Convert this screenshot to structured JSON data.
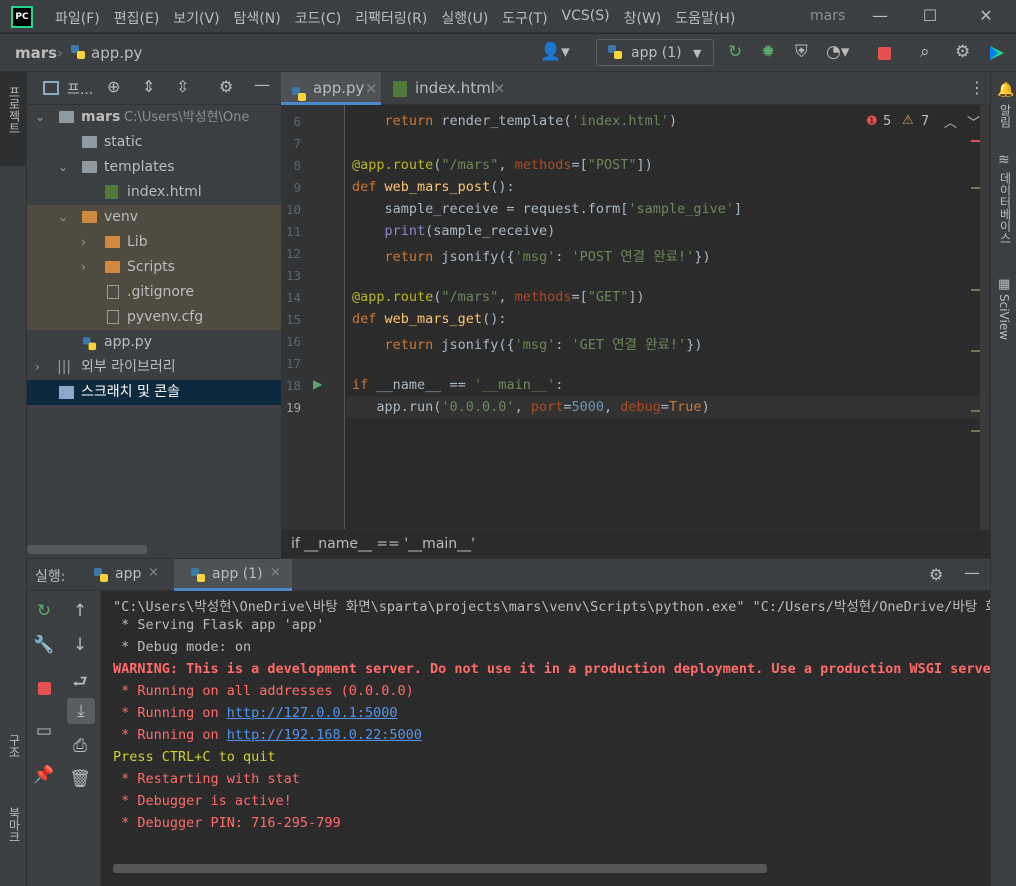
{
  "menubar": {
    "logo": "PC",
    "items": [
      "파일(F)",
      "편집(E)",
      "보기(V)",
      "탐색(N)",
      "코드(C)",
      "리팩터링(R)",
      "실행(U)",
      "도구(T)",
      "VCS(S)",
      "창(W)",
      "도움말(H)"
    ],
    "project_name": "mars",
    "minimize": "—",
    "maximize": "☐",
    "close": "✕"
  },
  "navbar": {
    "breadcrumb_root": "mars",
    "breadcrumb_file": "app.py",
    "run_config": "app (1)"
  },
  "left_strip": {
    "project_label": "프로젝트",
    "structure_label": "구조",
    "bookmarks_label": "북마크"
  },
  "right_strip": {
    "notifications_label": "알림",
    "database_label": "데이터베이스",
    "sciview_label": "SciView"
  },
  "project_panel": {
    "title": "프...",
    "tree": [
      {
        "label": "mars",
        "path": "C:\\Users\\박성현\\One"
      },
      {
        "label": "static"
      },
      {
        "label": "templates"
      },
      {
        "label": "index.html"
      },
      {
        "label": "venv"
      },
      {
        "label": "Lib"
      },
      {
        "label": "Scripts"
      },
      {
        "label": ".gitignore"
      },
      {
        "label": "pyvenv.cfg"
      },
      {
        "label": "app.py"
      },
      {
        "label": "외부 라이브러리"
      },
      {
        "label": "스크래치 및 콘솔"
      }
    ]
  },
  "editor": {
    "tabs": [
      {
        "label": "app.py",
        "active": true
      },
      {
        "label": "index.html",
        "active": false
      }
    ],
    "errors": "5",
    "warnings": "7",
    "line_numbers": [
      "6",
      "7",
      "8",
      "9",
      "10",
      "11",
      "12",
      "13",
      "14",
      "15",
      "16",
      "17",
      "18",
      "19"
    ],
    "breadcrumb": "if __name__ == '__main__'"
  },
  "run_panel": {
    "title": "실행:",
    "tabs": [
      {
        "label": "app",
        "active": false
      },
      {
        "label": "app (1)",
        "active": true
      }
    ],
    "console": {
      "line1": "\"C:\\Users\\박성현\\OneDrive\\바탕 화면\\sparta\\projects\\mars\\venv\\Scripts\\python.exe\" \"C:/Users/박성현/OneDrive/바탕 화",
      "line2": " * Serving Flask app 'app'",
      "line3": " * Debug mode: on",
      "line4": "WARNING: This is a development server. Do not use it in a production deployment. Use a production WSGI server",
      "line5": " * Running on all addresses (0.0.0.0)",
      "line6_prefix": " * Running on ",
      "line6_link": "http://127.0.0.1:5000",
      "line7_prefix": " * Running on ",
      "line7_link": "http://192.168.0.22:5000",
      "line8": "Press CTRL+C to quit",
      "line9": " * Restarting with stat",
      "line10": " * Debugger is active!",
      "line11": " * Debugger PIN: 716-295-799"
    }
  }
}
